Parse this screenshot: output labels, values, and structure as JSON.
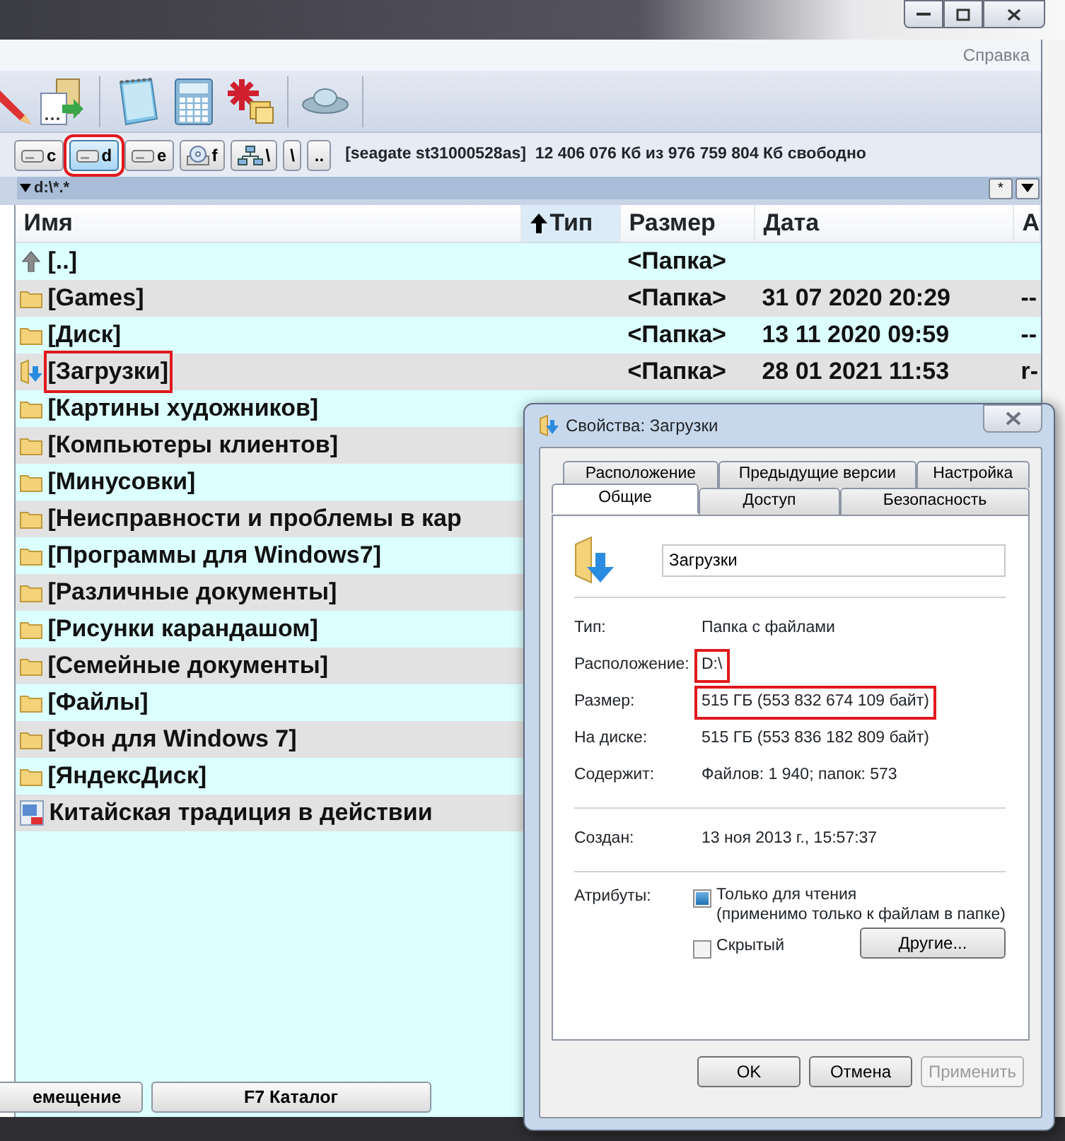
{
  "menu": {
    "items": [
      "Справка"
    ]
  },
  "drives": [
    {
      "label": "c",
      "kind": "disk",
      "selected": false,
      "highlighted": false
    },
    {
      "label": "d",
      "kind": "disk",
      "selected": true,
      "highlighted": true
    },
    {
      "label": "e",
      "kind": "disk",
      "selected": false,
      "highlighted": false
    },
    {
      "label": "f",
      "kind": "cd",
      "selected": false,
      "highlighted": false
    },
    {
      "label": "\\",
      "kind": "network",
      "selected": false,
      "highlighted": false
    },
    {
      "label": "\\",
      "kind": "plain",
      "selected": false,
      "highlighted": false
    },
    {
      "label": "..",
      "kind": "plain",
      "selected": false,
      "highlighted": false
    }
  ],
  "drive_info": "[seagate st31000528as]  12 406 076 Кб из 976 759 804 Кб свободно",
  "path": "d:\\*.*",
  "path_buttons": [
    "*"
  ],
  "columns": [
    {
      "label": "Имя",
      "sorted": false
    },
    {
      "label": "Тип",
      "sorted": true
    },
    {
      "label": "Размер",
      "sorted": false
    },
    {
      "label": "Дата",
      "sorted": false
    },
    {
      "label": "A",
      "sorted": false
    }
  ],
  "rows": [
    {
      "kind": "up",
      "name": "[..]",
      "size": "<Папка>",
      "highlighted": false
    },
    {
      "kind": "folder",
      "name": "[Games]",
      "size": "<Папка>",
      "date": "31 07 2020 20:29",
      "attr": "--",
      "highlighted": false
    },
    {
      "kind": "folder",
      "name": "[Диск]",
      "size": "<Папка>",
      "date": "13 11 2020 09:59",
      "attr": "--",
      "highlighted": false
    },
    {
      "kind": "download",
      "name": "[Загрузки]",
      "size": "<Папка>",
      "date": "28 01 2021 11:53",
      "attr": "r-",
      "highlighted": true
    },
    {
      "kind": "folder",
      "name": "[Картины художников]",
      "highlighted": false
    },
    {
      "kind": "folder",
      "name": "[Компьютеры клиентов]",
      "highlighted": false
    },
    {
      "kind": "folder",
      "name": "[Минусовки]",
      "highlighted": false
    },
    {
      "kind": "folder",
      "name": "[Неисправности и проблемы в кар",
      "highlighted": false
    },
    {
      "kind": "folder",
      "name": "[Программы для Windows7]",
      "highlighted": false
    },
    {
      "kind": "folder",
      "name": "[Различные документы]",
      "highlighted": false
    },
    {
      "kind": "folder",
      "name": "[Рисунки карандашом]",
      "highlighted": false
    },
    {
      "kind": "folder",
      "name": "[Семейные документы]",
      "highlighted": false
    },
    {
      "kind": "folder",
      "name": "[Файлы]",
      "highlighted": false
    },
    {
      "kind": "folder",
      "name": "[Фон для Windows 7]",
      "highlighted": false
    },
    {
      "kind": "folder",
      "name": "[ЯндексДиск]",
      "highlighted": false
    },
    {
      "kind": "file",
      "name": "Китайская традиция в действии",
      "highlighted": false
    }
  ],
  "function_keys": [
    "емещение",
    "F7 Каталог"
  ],
  "dialog": {
    "title": "Свойства: Загрузки",
    "tab_rows": [
      [
        {
          "label": "Расположение",
          "selected": false
        },
        {
          "label": "Предыдущие версии",
          "selected": false
        },
        {
          "label": "Настройка",
          "selected": false
        }
      ],
      [
        {
          "label": "Общие",
          "selected": true
        },
        {
          "label": "Доступ",
          "selected": false
        },
        {
          "label": "Безопасность",
          "selected": false
        }
      ]
    ],
    "name_field": "Загрузки",
    "properties": [
      {
        "label": "Тип:",
        "value": "Папка с файлами",
        "highlighted": false
      },
      {
        "label": "Расположение:",
        "value": "D:\\",
        "highlighted": true
      },
      {
        "label": "Размер:",
        "value": "515 ГБ (553 832 674 109 байт)",
        "highlighted": true
      },
      {
        "label": "На диске:",
        "value": "515 ГБ (553 836 182 809 байт)",
        "highlighted": false
      },
      {
        "label": "Содержит:",
        "value": "Файлов: 1 940; папок: 573",
        "highlighted": false
      }
    ],
    "created": {
      "label": "Создан:",
      "value": "13 ноя 2013 г., 15:57:37"
    },
    "attributes": {
      "label": "Атрибуты:",
      "items": [
        {
          "label": "Только для чтения",
          "note": "(применимо только к файлам в папке)",
          "checked": true
        },
        {
          "label": "Скрытый",
          "checked": false
        }
      ],
      "button": "Другие..."
    },
    "buttons": [
      {
        "label": "OK",
        "disabled": false
      },
      {
        "label": "Отмена",
        "disabled": false
      },
      {
        "label": "Применить",
        "disabled": true
      }
    ]
  }
}
